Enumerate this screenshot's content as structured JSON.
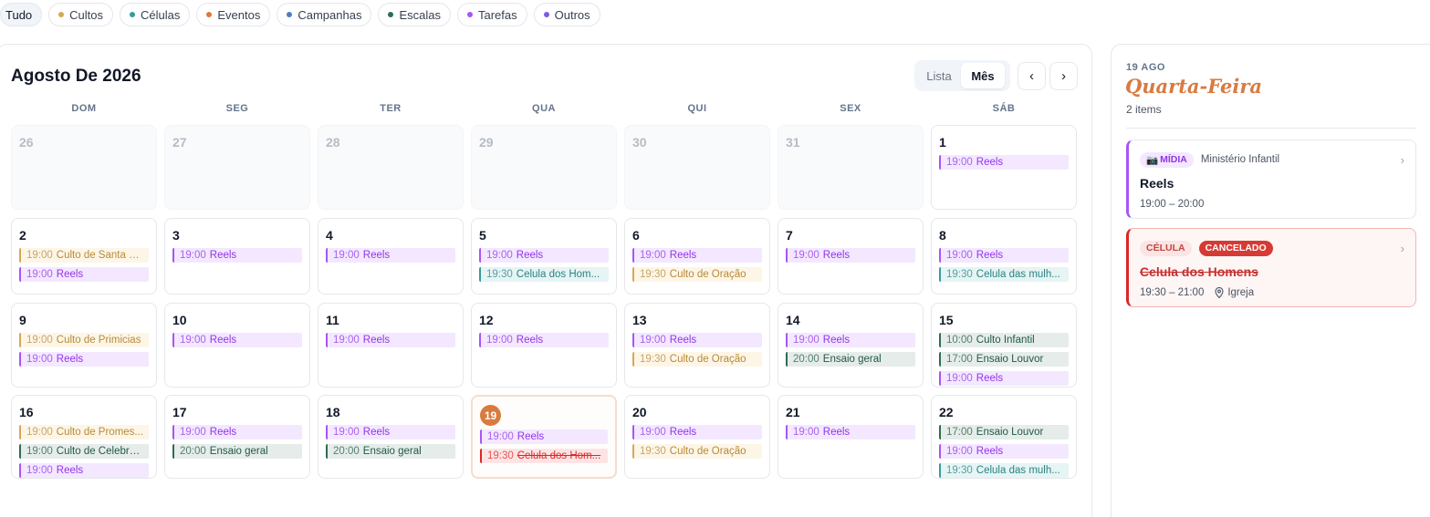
{
  "filters": [
    {
      "label": "Tudo",
      "active": true,
      "color": ""
    },
    {
      "label": "Cultos",
      "active": false,
      "color": "#d6a855"
    },
    {
      "label": "Células",
      "active": false,
      "color": "#3b9a9c"
    },
    {
      "label": "Eventos",
      "active": false,
      "color": "#d97a3f"
    },
    {
      "label": "Campanhas",
      "active": false,
      "color": "#4a7fc4"
    },
    {
      "label": "Escalas",
      "active": false,
      "color": "#2f6b55"
    },
    {
      "label": "Tarefas",
      "active": false,
      "color": "#a855f7"
    },
    {
      "label": "Outros",
      "active": false,
      "color": "#7c5ce0"
    }
  ],
  "calendar": {
    "title": "Agosto De 2026",
    "view_list": "Lista",
    "view_month": "Mês",
    "prev_icon": "‹",
    "next_icon": "›",
    "weekdays": [
      "DOM",
      "SEG",
      "TER",
      "QUA",
      "QUI",
      "SEX",
      "SÁB"
    ],
    "weeks": [
      [
        {
          "day": "26",
          "out": true,
          "events": []
        },
        {
          "day": "27",
          "out": true,
          "events": []
        },
        {
          "day": "28",
          "out": true,
          "events": []
        },
        {
          "day": "29",
          "out": true,
          "events": []
        },
        {
          "day": "30",
          "out": true,
          "events": []
        },
        {
          "day": "31",
          "out": true,
          "events": []
        },
        {
          "day": "1",
          "events": [
            {
              "time": "19:00",
              "name": "Reels",
              "kind": "midia"
            }
          ]
        }
      ],
      [
        {
          "day": "2",
          "events": [
            {
              "time": "19:00",
              "name": "Culto de Santa C...",
              "kind": "culto"
            },
            {
              "time": "19:00",
              "name": "Reels",
              "kind": "midia"
            }
          ]
        },
        {
          "day": "3",
          "events": [
            {
              "time": "19:00",
              "name": "Reels",
              "kind": "midia"
            }
          ]
        },
        {
          "day": "4",
          "events": [
            {
              "time": "19:00",
              "name": "Reels",
              "kind": "midia"
            }
          ]
        },
        {
          "day": "5",
          "events": [
            {
              "time": "19:00",
              "name": "Reels",
              "kind": "midia"
            },
            {
              "time": "19:30",
              "name": "Celula dos Hom...",
              "kind": "celula"
            }
          ]
        },
        {
          "day": "6",
          "events": [
            {
              "time": "19:00",
              "name": "Reels",
              "kind": "midia"
            },
            {
              "time": "19:30",
              "name": "Culto de Oração",
              "kind": "culto"
            }
          ]
        },
        {
          "day": "7",
          "events": [
            {
              "time": "19:00",
              "name": "Reels",
              "kind": "midia"
            }
          ]
        },
        {
          "day": "8",
          "events": [
            {
              "time": "19:00",
              "name": "Reels",
              "kind": "midia"
            },
            {
              "time": "19:30",
              "name": "Celula das mulh...",
              "kind": "celula"
            }
          ]
        }
      ],
      [
        {
          "day": "9",
          "events": [
            {
              "time": "19:00",
              "name": "Culto de Primicias",
              "kind": "culto"
            },
            {
              "time": "19:00",
              "name": "Reels",
              "kind": "midia"
            }
          ]
        },
        {
          "day": "10",
          "events": [
            {
              "time": "19:00",
              "name": "Reels",
              "kind": "midia"
            }
          ]
        },
        {
          "day": "11",
          "events": [
            {
              "time": "19:00",
              "name": "Reels",
              "kind": "midia"
            }
          ]
        },
        {
          "day": "12",
          "events": [
            {
              "time": "19:00",
              "name": "Reels",
              "kind": "midia"
            }
          ]
        },
        {
          "day": "13",
          "events": [
            {
              "time": "19:00",
              "name": "Reels",
              "kind": "midia"
            },
            {
              "time": "19:30",
              "name": "Culto de Oração",
              "kind": "culto"
            }
          ]
        },
        {
          "day": "14",
          "events": [
            {
              "time": "19:00",
              "name": "Reels",
              "kind": "midia"
            },
            {
              "time": "20:00",
              "name": "Ensaio geral",
              "kind": "escala"
            }
          ]
        },
        {
          "day": "15",
          "events": [
            {
              "time": "10:00",
              "name": "Culto Infantil",
              "kind": "escala"
            },
            {
              "time": "17:00",
              "name": "Ensaio Louvor",
              "kind": "escala"
            },
            {
              "time": "19:00",
              "name": "Reels",
              "kind": "midia"
            }
          ]
        }
      ],
      [
        {
          "day": "16",
          "events": [
            {
              "time": "19:00",
              "name": "Culto de Promes...",
              "kind": "culto"
            },
            {
              "time": "19:00",
              "name": "Culto de Celebra...",
              "kind": "escala"
            },
            {
              "time": "19:00",
              "name": "Reels",
              "kind": "midia"
            }
          ]
        },
        {
          "day": "17",
          "events": [
            {
              "time": "19:00",
              "name": "Reels",
              "kind": "midia"
            },
            {
              "time": "20:00",
              "name": "Ensaio geral",
              "kind": "escala"
            }
          ]
        },
        {
          "day": "18",
          "events": [
            {
              "time": "19:00",
              "name": "Reels",
              "kind": "midia"
            },
            {
              "time": "20:00",
              "name": "Ensaio geral",
              "kind": "escala"
            }
          ]
        },
        {
          "day": "19",
          "today": true,
          "events": [
            {
              "time": "19:00",
              "name": "Reels",
              "kind": "midia"
            },
            {
              "time": "19:30",
              "name": "Celula dos Hom...",
              "kind": "cancel"
            }
          ]
        },
        {
          "day": "20",
          "events": [
            {
              "time": "19:00",
              "name": "Reels",
              "kind": "midia"
            },
            {
              "time": "19:30",
              "name": "Culto de Oração",
              "kind": "culto"
            }
          ]
        },
        {
          "day": "21",
          "events": [
            {
              "time": "19:00",
              "name": "Reels",
              "kind": "midia"
            }
          ]
        },
        {
          "day": "22",
          "events": [
            {
              "time": "17:00",
              "name": "Ensaio Louvor",
              "kind": "escala"
            },
            {
              "time": "19:00",
              "name": "Reels",
              "kind": "midia"
            },
            {
              "time": "19:30",
              "name": "Celula das mulh...",
              "kind": "celula"
            }
          ]
        }
      ]
    ]
  },
  "side": {
    "date": "19 AGO",
    "weekday": "Quarta-Feira",
    "count": "2 items",
    "cards": [
      {
        "badge_icon": "📷",
        "badge": "MÍDIA",
        "ministry": "Ministério Infantil",
        "title": "Reels",
        "time": "19:00 – 20:00"
      },
      {
        "badge": "CÉLULA",
        "status": "CANCELADO",
        "title": "Celula dos Homens",
        "time": "19:30 – 21:00",
        "location": "Igreja"
      }
    ],
    "chevron": "›"
  }
}
